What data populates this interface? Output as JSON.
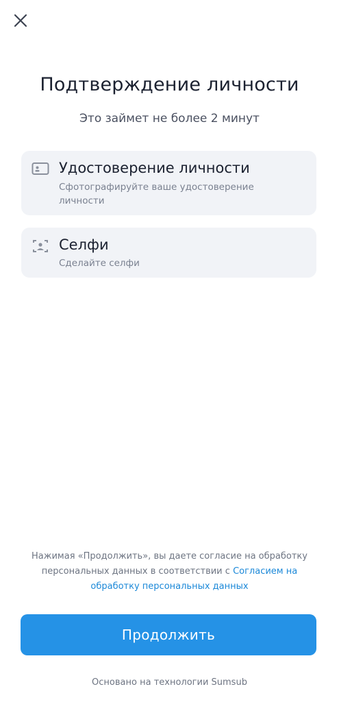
{
  "header": {
    "close_icon": "close-icon"
  },
  "main": {
    "title": "Подтверждение личности",
    "subtitle": "Это займет не более 2 минут",
    "steps": [
      {
        "icon": "id-card-icon",
        "title": "Удостоверение личности",
        "description": "Сфотографируйте ваше удостоверение личности"
      },
      {
        "icon": "selfie-icon",
        "title": "Селфи",
        "description": "Сделайте селфи"
      }
    ]
  },
  "footer": {
    "consent_text": "Нажимая «Продолжить», вы даете согласие на обработку персональных данных в соответствии с",
    "consent_link": "Согласием на обработку персональных данных",
    "continue_label": "Продолжить",
    "powered_by": "Основано на технологии Sumsub"
  },
  "colors": {
    "accent": "#2592e6",
    "link": "#1b88d8",
    "card_background": "#f1f3f7",
    "title_text": "#1b2130",
    "secondary_text": "#6d7482"
  }
}
